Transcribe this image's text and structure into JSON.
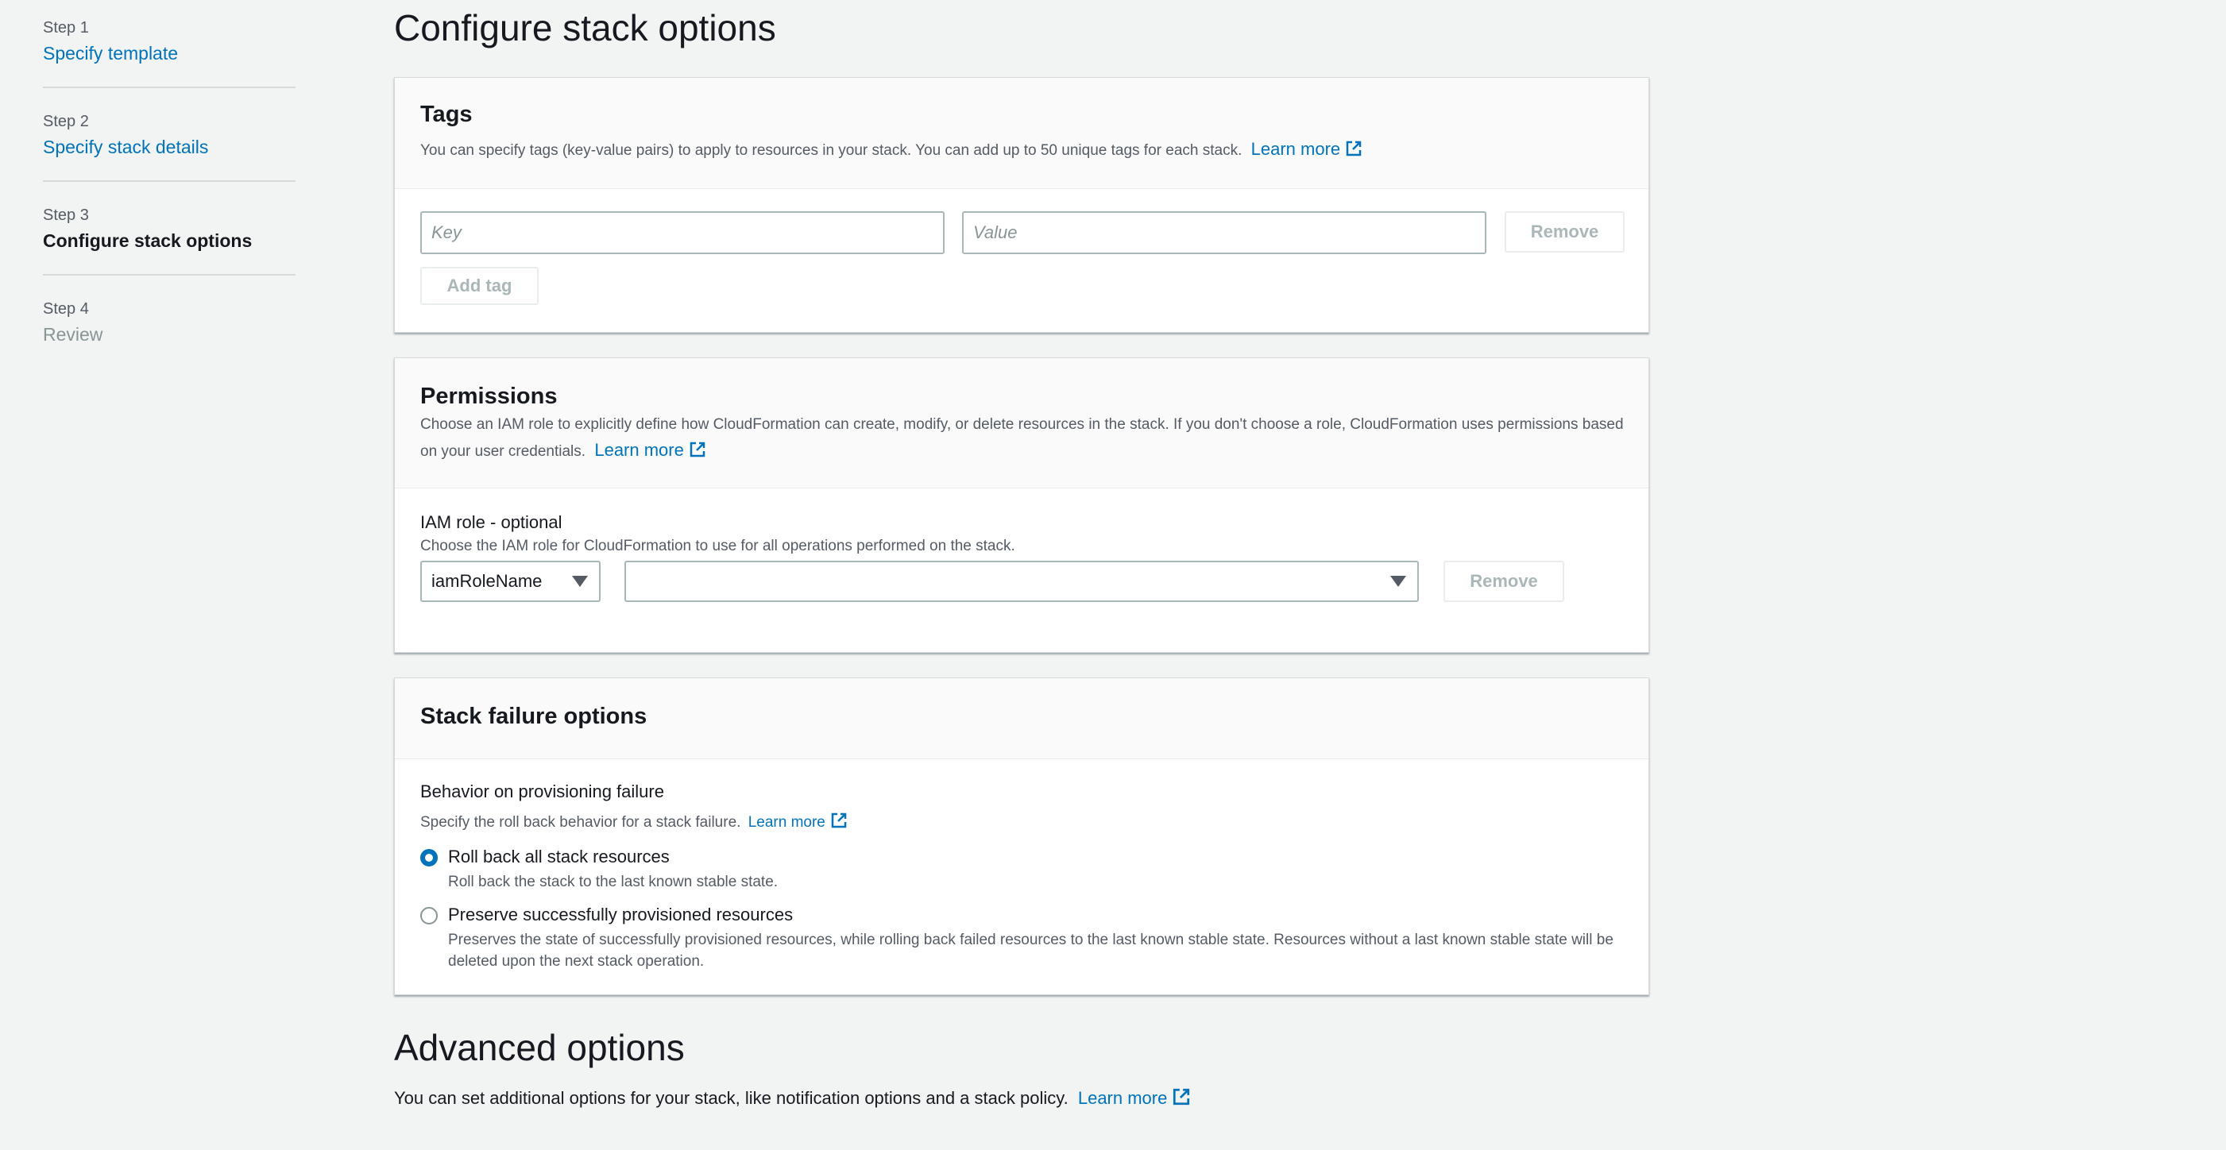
{
  "sidebar": {
    "steps": [
      {
        "number": "Step 1",
        "label": "Specify template"
      },
      {
        "number": "Step 2",
        "label": "Specify stack details"
      },
      {
        "number": "Step 3",
        "label": "Configure stack options"
      },
      {
        "number": "Step 4",
        "label": "Review"
      }
    ]
  },
  "page_title": "Configure stack options",
  "tags": {
    "title": "Tags",
    "description": "You can specify tags (key-value pairs) to apply to resources in your stack. You can add up to 50 unique tags for each stack.",
    "learn_more": "Learn more",
    "key_placeholder": "Key",
    "value_placeholder": "Value",
    "remove_label": "Remove",
    "add_tag_label": "Add tag"
  },
  "permissions": {
    "title": "Permissions",
    "description": "Choose an IAM role to explicitly define how CloudFormation can create, modify, or delete resources in the stack. If you don't choose a role, CloudFormation uses permissions based on your user credentials.",
    "learn_more": "Learn more",
    "iam_label": "IAM role - optional",
    "iam_desc": "Choose the IAM role for CloudFormation to use for all operations performed on the stack.",
    "role_type_value": "iamRoleName",
    "role_value": "",
    "remove_label": "Remove"
  },
  "stack_failure": {
    "title": "Stack failure options",
    "behavior_label": "Behavior on provisioning failure",
    "behavior_desc": "Specify the roll back behavior for a stack failure.",
    "learn_more": "Learn more",
    "options": [
      {
        "label": "Roll back all stack resources",
        "desc": "Roll back the stack to the last known stable state.",
        "selected": true
      },
      {
        "label": "Preserve successfully provisioned resources",
        "desc": "Preserves the state of successfully provisioned resources, while rolling back failed resources to the last known stable state. Resources without a last known stable state will be deleted upon the next stack operation.",
        "selected": false
      }
    ]
  },
  "advanced": {
    "title": "Advanced options",
    "description": "You can set additional options for your stack, like notification options and a stack policy.",
    "learn_more": "Learn more"
  },
  "colors": {
    "link": "#0073bb",
    "background": "#f2f3f3",
    "radio_selected": "#0073bb"
  },
  "icons": [
    "external-link-icon",
    "caret-down-icon"
  ]
}
